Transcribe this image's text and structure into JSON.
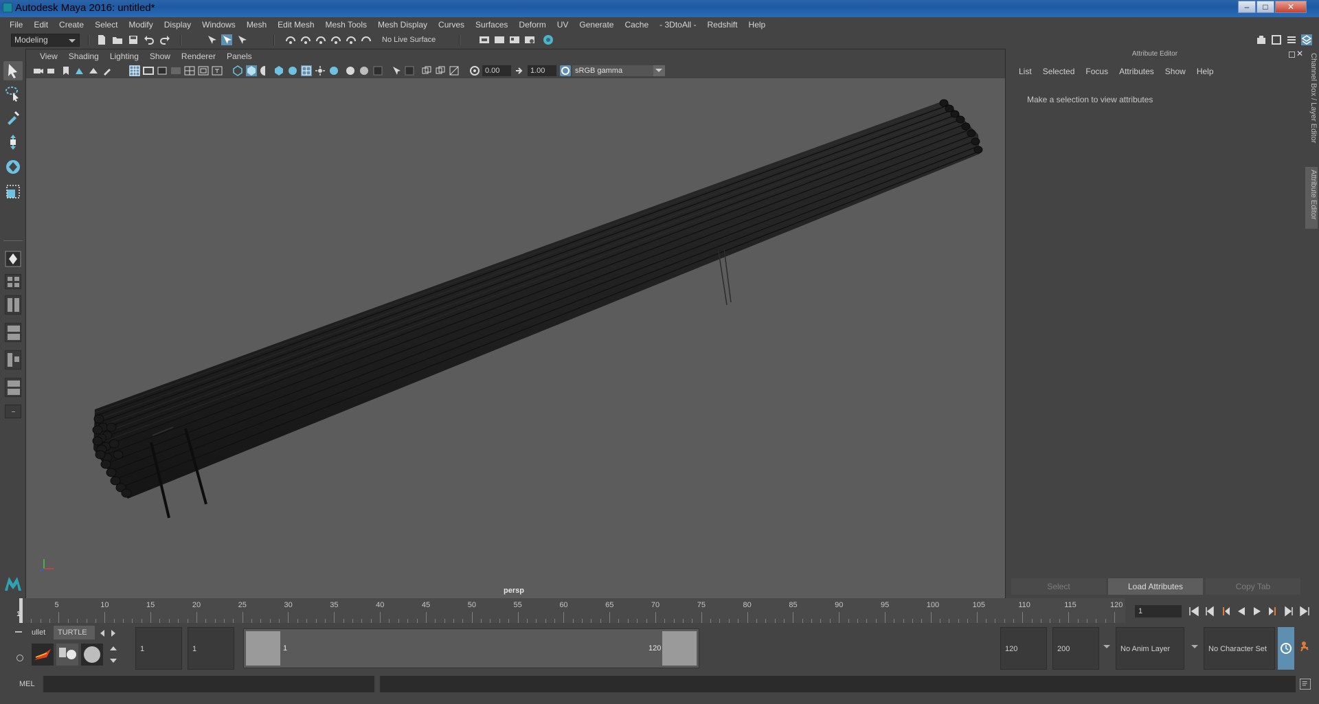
{
  "window": {
    "title": "Autodesk Maya 2016: untitled*"
  },
  "menubar": [
    "File",
    "Edit",
    "Create",
    "Select",
    "Modify",
    "Display",
    "Windows",
    "Mesh",
    "Edit Mesh",
    "Mesh Tools",
    "Mesh Display",
    "Curves",
    "Surfaces",
    "Deform",
    "UV",
    "Generate",
    "Cache",
    "- 3DtoAll -",
    "Redshift",
    "Help"
  ],
  "statusline": {
    "mode": "Modeling",
    "live_surface": "No Live Surface"
  },
  "viewport": {
    "menu": [
      "View",
      "Shading",
      "Lighting",
      "Show",
      "Renderer",
      "Panels"
    ],
    "exposure": "0.00",
    "gamma": "1.00",
    "color_space": "sRGB gamma",
    "camera": "persp"
  },
  "attribute_editor": {
    "header": "Attribute Editor",
    "menu": [
      "List",
      "Selected",
      "Focus",
      "Attributes",
      "Show",
      "Help"
    ],
    "message": "Make a selection to view attributes",
    "buttons": {
      "select": "Select",
      "load": "Load Attributes",
      "copy": "Copy Tab"
    }
  },
  "side_tabs": {
    "channel_box": "Channel Box / Layer Editor",
    "attribute_editor": "Attribute Editor"
  },
  "timeline": {
    "ticks": [
      "5",
      "10",
      "15",
      "20",
      "25",
      "30",
      "35",
      "40",
      "45",
      "50",
      "55",
      "60",
      "65",
      "70",
      "75",
      "80",
      "85",
      "90",
      "95",
      "100",
      "105",
      "110",
      "115",
      "120"
    ],
    "current_frame_marker": "1",
    "current_frame": "1"
  },
  "shelf": {
    "tabs": [
      "ullet",
      "TURTLE"
    ]
  },
  "range": {
    "start": "1",
    "playback_start": "1",
    "slider_start": "1",
    "slider_end": "120",
    "playback_end": "120",
    "end": "200",
    "anim_layer": "No Anim Layer",
    "character_set": "No Character Set"
  },
  "command_line": {
    "label": "MEL"
  }
}
